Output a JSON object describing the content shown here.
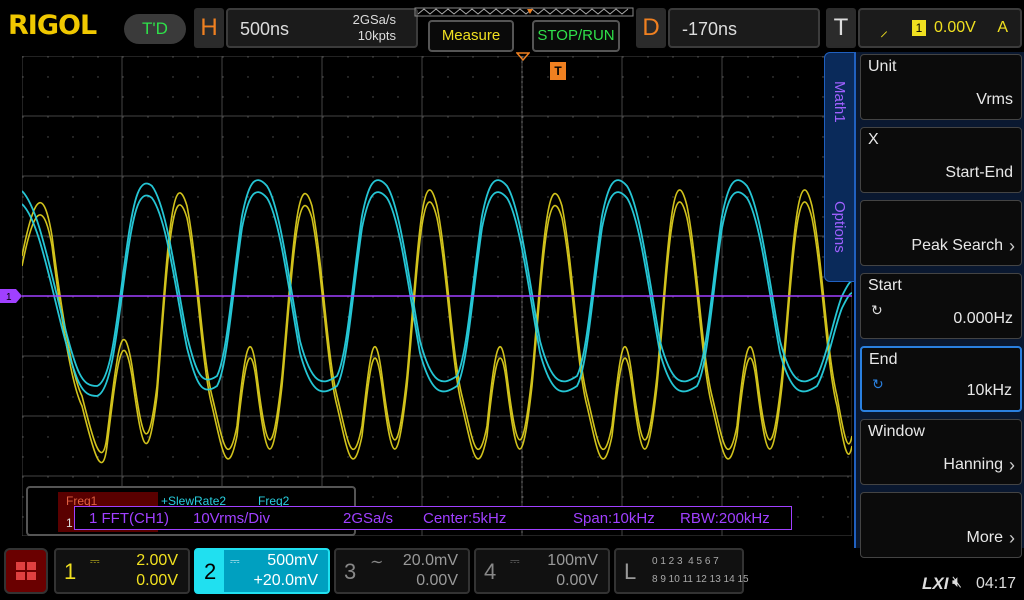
{
  "brand": "RIGOL",
  "run_state": "T'D",
  "horizontal": {
    "letter": "H",
    "timebase": "500ns",
    "sample_rate": "2GSa/s",
    "memory": "10kpts"
  },
  "buttons": {
    "measure": "Measure",
    "stop_run": "STOP/RUN"
  },
  "delay": {
    "letter": "D",
    "value": "-170ns"
  },
  "trigger": {
    "letter": "T",
    "source": "1",
    "level": "0.00V",
    "mode": "A"
  },
  "side_tabs": {
    "math": "Math1",
    "options": "Options"
  },
  "menu": [
    {
      "label": "Unit",
      "value": "Vrms"
    },
    {
      "label": "X",
      "value": "Start-End"
    },
    {
      "label": "",
      "value": "Peak Search"
    },
    {
      "label": "Start",
      "value": "0.000Hz"
    },
    {
      "label": "End",
      "value": "10kHz"
    },
    {
      "label": "Window",
      "value": "Hanning"
    },
    {
      "label": "",
      "value": "More"
    }
  ],
  "measure_tabs": {
    "t1": "Freq1",
    "t2": "+SlewRate2",
    "t3": "Freq2"
  },
  "fft_info": {
    "index": "1",
    "title": "1 FFT(CH1)",
    "scale": "10Vrms/Div",
    "rate": "2GSa/s",
    "center": "Center:5kHz",
    "span": "Span:10kHz",
    "rbw": "RBW:200kHz"
  },
  "channels": [
    {
      "num": "1",
      "scale": "2.00V",
      "offset": "0.00V",
      "color": "#f0e020"
    },
    {
      "num": "2",
      "scale": "500mV",
      "offset": "+20.0mV",
      "color": "#20e0f0"
    },
    {
      "num": "3",
      "scale": "20.0mV",
      "offset": "0.00V",
      "color": "#777777"
    },
    {
      "num": "4",
      "scale": "100mV",
      "offset": "0.00V",
      "color": "#777777"
    }
  ],
  "logic": {
    "letter": "L",
    "row1": "0 1 2 3  4 5 6 7",
    "row2": "8 9 10 11 12 13 14 15"
  },
  "status": {
    "lxi": "LXI",
    "clock": "04:17"
  },
  "colors": {
    "ch1": "#e8d820",
    "ch2": "#28d0e0",
    "math": "#a040ff",
    "accent": "#f08020"
  }
}
